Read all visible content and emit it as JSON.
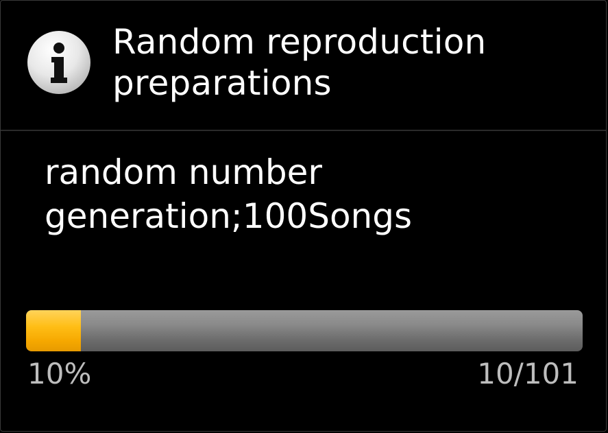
{
  "dialog": {
    "title": "Random reproduction preparations",
    "icon": "info-icon",
    "message": "random number generation;100Songs"
  },
  "progress": {
    "percent_label": "10%",
    "count_label": "10/101",
    "current": 10,
    "total": 101,
    "fill_color": "#ffbe16",
    "track_color": "#7a7a7a"
  }
}
